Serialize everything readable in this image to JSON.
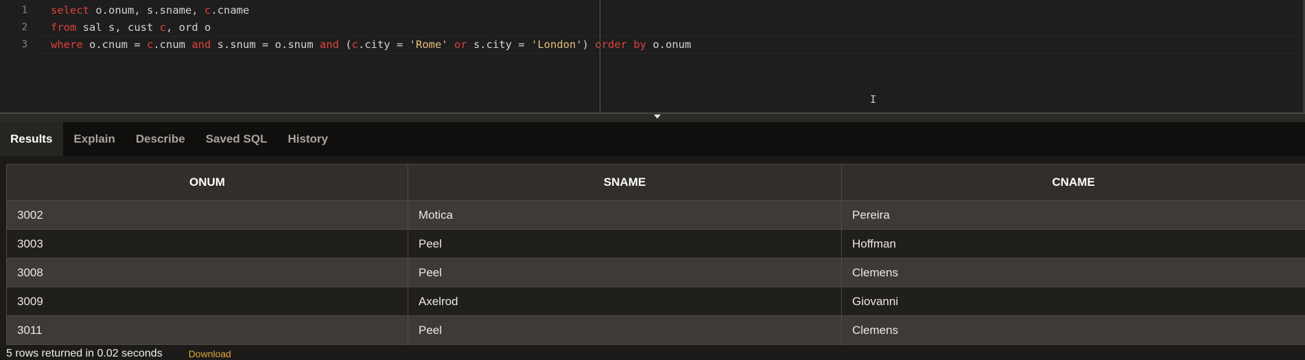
{
  "editor": {
    "line_numbers": [
      "1",
      "2",
      "3"
    ],
    "lines": [
      [
        {
          "t": "select",
          "k": "kw"
        },
        {
          "t": " o.onum, s.sname, ",
          "k": "id"
        },
        {
          "t": "c",
          "k": "kw"
        },
        {
          "t": ".cname",
          "k": "id"
        }
      ],
      [
        {
          "t": "from",
          "k": "kw"
        },
        {
          "t": " sal s, cust ",
          "k": "id"
        },
        {
          "t": "c",
          "k": "kw"
        },
        {
          "t": ", ord o",
          "k": "id"
        }
      ],
      [
        {
          "t": "where",
          "k": "kw"
        },
        {
          "t": " o.cnum = ",
          "k": "id"
        },
        {
          "t": "c",
          "k": "kw"
        },
        {
          "t": ".cnum ",
          "k": "id"
        },
        {
          "t": "and",
          "k": "kw"
        },
        {
          "t": " s.snum = o.snum ",
          "k": "id"
        },
        {
          "t": "and",
          "k": "kw"
        },
        {
          "t": " (",
          "k": "id"
        },
        {
          "t": "c",
          "k": "kw"
        },
        {
          "t": ".city = ",
          "k": "id"
        },
        {
          "t": "'Rome'",
          "k": "str"
        },
        {
          "t": " ",
          "k": "id"
        },
        {
          "t": "or",
          "k": "kw"
        },
        {
          "t": " s.city = ",
          "k": "id"
        },
        {
          "t": "'London'",
          "k": "str"
        },
        {
          "t": ") ",
          "k": "id"
        },
        {
          "t": "order",
          "k": "kw"
        },
        {
          "t": " ",
          "k": "id"
        },
        {
          "t": "by",
          "k": "kw"
        },
        {
          "t": " o.onum",
          "k": "id"
        }
      ]
    ],
    "cursor_icon": "text-cursor-icon",
    "cursor_glyph": "I"
  },
  "splitter": {
    "handle_icon": "triangle-down-icon"
  },
  "tabs": {
    "results": "Results",
    "explain": "Explain",
    "describe": "Describe",
    "saved_sql": "Saved SQL",
    "history": "History",
    "active": "Results"
  },
  "results": {
    "columns": [
      "ONUM",
      "SNAME",
      "CNAME"
    ],
    "rows": [
      [
        "3002",
        "Motica",
        "Pereira"
      ],
      [
        "3003",
        "Peel",
        "Hoffman"
      ],
      [
        "3008",
        "Peel",
        "Clemens"
      ],
      [
        "3009",
        "Axelrod",
        "Giovanni"
      ],
      [
        "3011",
        "Peel",
        "Clemens"
      ]
    ]
  },
  "footer": {
    "status": "5 rows returned in 0.02 seconds",
    "download": "Download"
  },
  "colors": {
    "keyword": "#e0413c",
    "string": "#e6c07b",
    "download_link": "#e0a63a"
  }
}
